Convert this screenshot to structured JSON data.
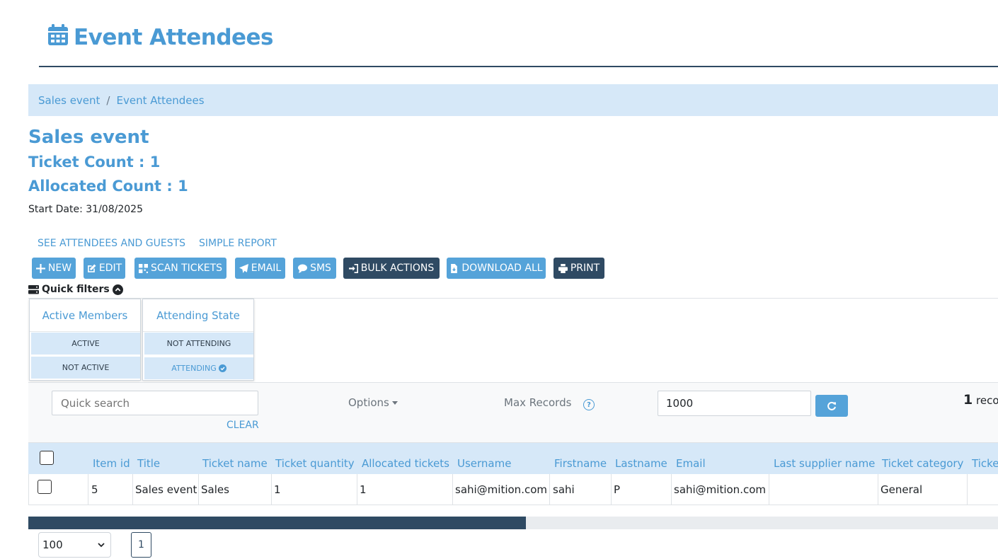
{
  "header": {
    "title": "Event Attendees",
    "icon": "calendar-icon"
  },
  "breadcrumb": {
    "items": [
      "Sales event",
      "Event Attendees"
    ],
    "separator": "/"
  },
  "event": {
    "name": "Sales event",
    "ticket_count": "Ticket Count : 1",
    "allocated_count": "Allocated Count : 1",
    "start_date": "Start Date: 31/08/2025"
  },
  "links": {
    "attendees": "SEE ATTENDEES AND GUESTS",
    "report": "SIMPLE REPORT"
  },
  "actions": {
    "new": "NEW",
    "edit": "EDIT",
    "scan": "SCAN TICKETS",
    "email": "EMAIL",
    "sms": "SMS",
    "bulk": "BULK ACTIONS",
    "download": "DOWNLOAD ALL",
    "print": "PRINT"
  },
  "quick_filters": {
    "label": "Quick filters",
    "groups": [
      {
        "title": "Active Members",
        "options": [
          "ACTIVE",
          "NOT ACTIVE"
        ]
      },
      {
        "title": "Attending State",
        "options": [
          "NOT ATTENDING",
          "ATTENDING"
        ],
        "selected": "ATTENDING"
      }
    ]
  },
  "toolbar": {
    "search_placeholder": "Quick search",
    "clear": "CLEAR",
    "options": "Options",
    "max_records_label": "Max Records",
    "max_records_value": "1000",
    "records_count": "1",
    "records_suffix": "recor"
  },
  "table": {
    "columns": [
      "Item id",
      "Title",
      "Ticket name",
      "Ticket quantity",
      "Allocated tickets",
      "Username",
      "Firstname",
      "Lastname",
      "Email",
      "Last supplier name",
      "Ticket category",
      "Ticke"
    ],
    "rows": [
      [
        "5",
        "Sales event",
        "Sales",
        "1",
        "1",
        "sahi@mition.com",
        "sahi",
        "P",
        "sahi@mition.com",
        "",
        "General",
        ""
      ]
    ]
  },
  "pagination": {
    "page_size": "100",
    "current_page": "1"
  },
  "colors": {
    "accent": "#4a9ad4",
    "dark": "#2f4a63",
    "light_bg": "#d6e8f8",
    "button_light": "#55a3d9"
  }
}
